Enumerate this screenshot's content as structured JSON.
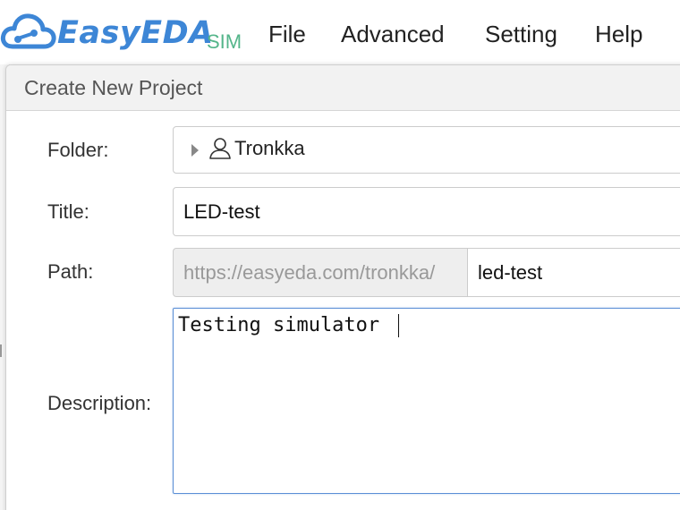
{
  "app": {
    "logo_text": "EasyEDA",
    "logo_subtitle": "SIM",
    "brand_colors": {
      "logo": "#3d86d6",
      "sim": "#54b58a",
      "focus_border": "#5b8fd6"
    }
  },
  "menu": {
    "items": [
      {
        "label": "File"
      },
      {
        "label": "Advanced"
      },
      {
        "label": "Setting"
      },
      {
        "label": "Help"
      }
    ]
  },
  "dialog": {
    "title": "Create New Project",
    "folder": {
      "label": "Folder:",
      "value": "Tronkka",
      "icons": [
        "caret-right-icon",
        "user-icon"
      ]
    },
    "title_field": {
      "label": "Title:",
      "value": "LED-test"
    },
    "path": {
      "label": "Path:",
      "prefix": "https://easyeda.com/tronkka/",
      "value": "led-test"
    },
    "description": {
      "label": "Description:",
      "value": "Testing simulator "
    }
  }
}
